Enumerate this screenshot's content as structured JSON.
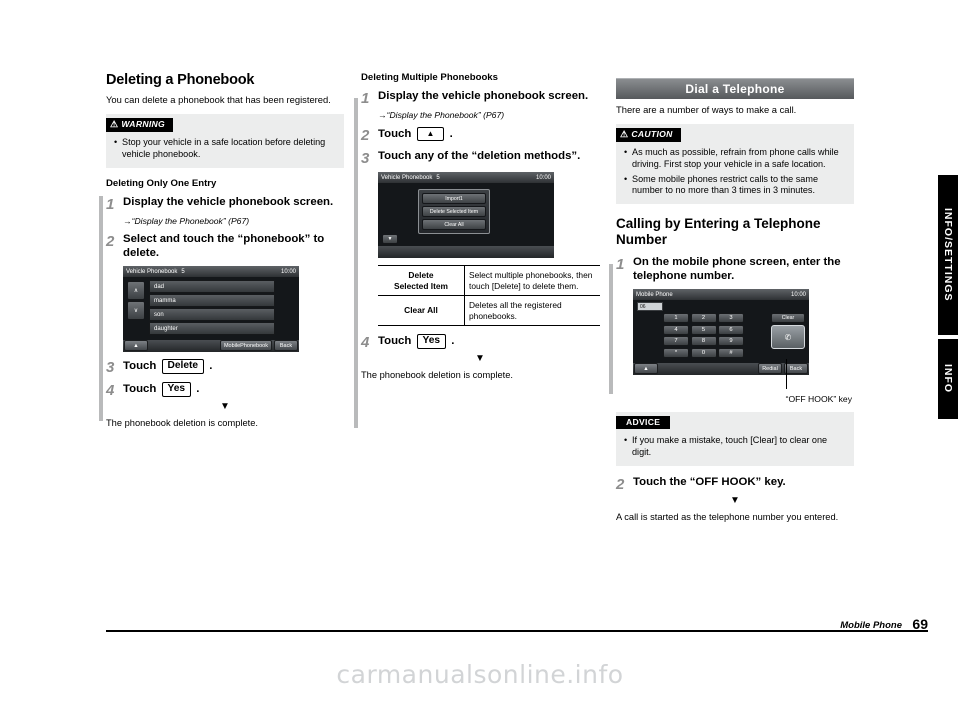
{
  "column1": {
    "heading": "Deleting a Phonebook",
    "intro": "You can delete a phonebook that has been registered.",
    "warning": {
      "tab_label": "WARNING",
      "items": [
        "Stop your vehicle in a safe location before deleting vehicle phonebook."
      ]
    },
    "subheading": "Deleting Only One Entry",
    "steps": [
      {
        "num": "1",
        "text": "Display the vehicle phonebook screen.",
        "ref": "“Display the Phonebook” (P67)"
      },
      {
        "num": "2",
        "text": "Select and touch the “phonebook” to delete."
      },
      {
        "num": "3",
        "text_before": "Touch",
        "key": "Delete",
        "text_after": "."
      },
      {
        "num": "4",
        "text_before": "Touch",
        "key": "Yes",
        "text_after": "."
      }
    ],
    "screen": {
      "title": "Vehicle Phonebook",
      "count": "5",
      "clock": "10:00",
      "rows": [
        "dad",
        "mamma",
        "son",
        "daughter"
      ],
      "scroll_up": "∧",
      "scroll_down": "∨",
      "bottom_left": "▲",
      "bottom_buttons": [
        "MobilePhonebook",
        "Back"
      ]
    },
    "result": "The phonebook deletion is complete."
  },
  "column2": {
    "heading": "Deleting Multiple Phonebooks",
    "steps": [
      {
        "num": "1",
        "text": "Display the vehicle phonebook screen.",
        "ref": "“Display the Phonebook” (P67)"
      },
      {
        "num": "2",
        "text_before": "Touch",
        "key": "▲",
        "text_after": "."
      },
      {
        "num": "3",
        "text": "Touch any of the “deletion methods”."
      },
      {
        "num": "4",
        "text_before": "Touch",
        "key": "Yes",
        "text_after": "."
      }
    ],
    "screen": {
      "title": "Vehicle Phonebook",
      "count": "5",
      "clock": "10:00",
      "popup_buttons": [
        "Import1",
        "Delete  Selected Item",
        "Clear  All"
      ],
      "down_arrow": "▼"
    },
    "table": {
      "rows": [
        {
          "label": "Delete\nSelected Item",
          "desc": "Select multiple phonebooks, then touch [Delete] to delete them."
        },
        {
          "label": "Clear All",
          "desc": "Deletes all the registered phonebooks."
        }
      ]
    },
    "result": "The phonebook deletion is complete."
  },
  "column3": {
    "banner": "Dial a Telephone",
    "intro": "There are a number of ways to make a call.",
    "caution": {
      "tab_label": "CAUTION",
      "items": [
        "As much as possible, refrain from phone calls while driving. First stop your vehicle in a safe location.",
        "Some mobile phones restrict calls to the same number to no more than 3 times in 3 minutes."
      ]
    },
    "heading2": "Calling by Entering a Telephone Number",
    "steps": [
      {
        "num": "1",
        "text": "On the mobile phone screen, enter the telephone number."
      },
      {
        "num": "2",
        "text": "Touch the “OFF HOOK” key."
      }
    ],
    "screen": {
      "title": "Mobile Phone",
      "clock": "10:00",
      "number_field": "06",
      "clear_label": "Clear",
      "keys": [
        "1",
        "2",
        "3",
        "4",
        "5",
        "6",
        "7",
        "8",
        "9",
        "*",
        "0",
        "#"
      ],
      "hook_icon": "✆",
      "bottom_left": "▲",
      "bottom_buttons": [
        "Redial",
        "Back"
      ]
    },
    "callout": "“OFF HOOK” key",
    "advice": {
      "tab_label": "ADVICE",
      "items": [
        "If you make a mistake, touch [Clear] to clear one digit."
      ]
    },
    "result": "A call is started as the telephone number you entered."
  },
  "side_tabs": {
    "primary": "INFO/SETTINGS",
    "secondary": "INFO"
  },
  "footer": {
    "section": "Mobile Phone",
    "page": "69"
  },
  "watermark": "carmanualsonline.info"
}
